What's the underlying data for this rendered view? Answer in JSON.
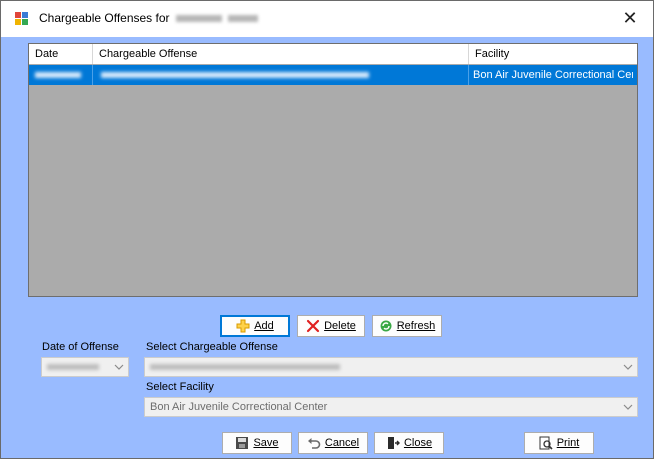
{
  "window": {
    "title": "Chargeable Offenses for",
    "close_glyph": "✕"
  },
  "grid": {
    "columns": [
      "Date",
      "Chargeable Offense",
      "Facility"
    ],
    "rows": [
      {
        "date": "",
        "offense": "",
        "facility": "Bon Air Juvenile Correctional Center",
        "selected": true
      }
    ]
  },
  "actions": {
    "add_label": "Add",
    "delete_label": "Delete",
    "refresh_label": "Refresh"
  },
  "form": {
    "date_label": "Date of Offense",
    "date_value": "",
    "offense_label": "Select Chargeable Offense",
    "offense_value": "",
    "facility_label": "Select Facility",
    "facility_value": "Bon Air Juvenile Correctional Center"
  },
  "footer": {
    "save_label": "Save",
    "cancel_label": "Cancel",
    "close_label": "Close",
    "print_label": "Print"
  },
  "colors": {
    "window_bg": "#99bbff",
    "grid_bg": "#ababab",
    "selection": "#0078d7"
  }
}
